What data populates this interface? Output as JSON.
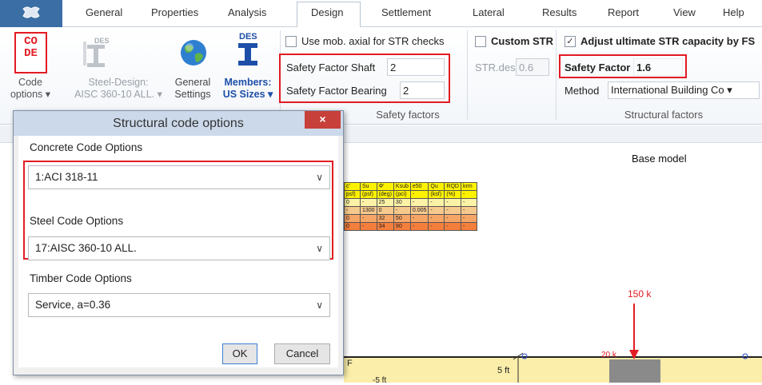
{
  "menu": {
    "tabs": [
      "General",
      "Properties",
      "Analysis",
      "Design",
      "Settlement",
      "Lateral",
      "Results",
      "Report",
      "View",
      "Help"
    ],
    "active_tab": "Design"
  },
  "ribbon": {
    "code_options": {
      "icon_top": "CO",
      "icon_bottom": "DE",
      "label_line1": "Code",
      "label_line2": "options ▾"
    },
    "steel_design": {
      "icon_text": "DES",
      "label_line1": "Steel-Design:",
      "label_line2": "AISC 360-10 ALL. ▾"
    },
    "general_settings": {
      "label_line1": "General",
      "label_line2": "Settings"
    },
    "members": {
      "icon_text": "DES",
      "label_line1": "Members:",
      "label_line2": "US Sizes ▾"
    },
    "use_mob_axial": "Use mob. axial for STR checks",
    "safety_factor_shaft": {
      "label": "Safety Factor Shaft",
      "value": "2"
    },
    "safety_factor_bearing": {
      "label": "Safety Factor Bearing",
      "value": "2"
    },
    "safety_factors_group": "Safety factors",
    "custom_str": "Custom STR",
    "str_des": {
      "label": "STR.des",
      "value": "0.6"
    },
    "adjust_ultimate": {
      "label": "Adjust ultimate STR capacity by FS",
      "checked_mark": "✓"
    },
    "safety_factor": {
      "label": "Safety Factor",
      "value": "1.6"
    },
    "method": {
      "label": "Method",
      "value": "International Building Co ▾"
    },
    "structural_factors_group": "Structural factors"
  },
  "canvas": {
    "title": "Base model",
    "load_label": "150 k",
    "load_small": "20 k",
    "dim_5ft": "5 ft",
    "dim_neg5ft": "-5 ft",
    "layer_letter": "F",
    "soil_header": [
      "c'",
      "Su",
      "Φ'",
      "Ksub",
      "e50",
      "Qu",
      "RQD",
      "krm"
    ],
    "soil_units": [
      "psf)",
      "(psf)",
      "(deg)",
      "(pci)",
      "-",
      "(ksf)",
      "(%)",
      "-"
    ],
    "soil_rows": [
      [
        "0",
        "-",
        "25",
        "30",
        "-",
        "-",
        "-",
        "-"
      ],
      [
        "-",
        "1300",
        "0",
        "-",
        "0.005",
        "-",
        "-",
        "-"
      ],
      [
        "0",
        "-",
        "32",
        "50",
        "-",
        "-",
        "-",
        "-"
      ],
      [
        "0",
        "-",
        "34",
        "90",
        "-",
        "-",
        "-",
        "-"
      ]
    ],
    "row_colors": [
      "#fdf3a7",
      "#f6c98c",
      "#f7a566",
      "#f47e3c"
    ],
    "header_color": "#fff200"
  },
  "dialog": {
    "title": "Structural code options",
    "close": "×",
    "concrete_label": "Concrete Code Options",
    "concrete_value": "1:ACI 318-11",
    "steel_label": "Steel Code Options",
    "steel_value": "17:AISC 360-10 ALL.",
    "timber_label": "Timber Code Options",
    "timber_value": "Service, a=0.36",
    "ok": "OK",
    "cancel": "Cancel"
  },
  "colors": {
    "highlight": "#e21b23",
    "load_arrow": "#e21b23"
  }
}
